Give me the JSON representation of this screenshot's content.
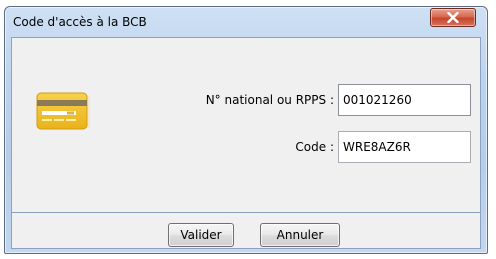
{
  "window": {
    "title": "Code d'accès à la BCB",
    "close_icon": "close-icon"
  },
  "icons": {
    "card": "credit-card-icon"
  },
  "form": {
    "rpps_label": "N° national ou RPPS :",
    "rpps_value": "001021260",
    "code_label": "Code :",
    "code_value": "WRE8AZ6R"
  },
  "buttons": {
    "validate_label": "Valider",
    "cancel_label": "Annuler"
  },
  "colors": {
    "close_button": "#c5462c",
    "card_gold": "#f2c230",
    "frame": "#b5cde9"
  }
}
